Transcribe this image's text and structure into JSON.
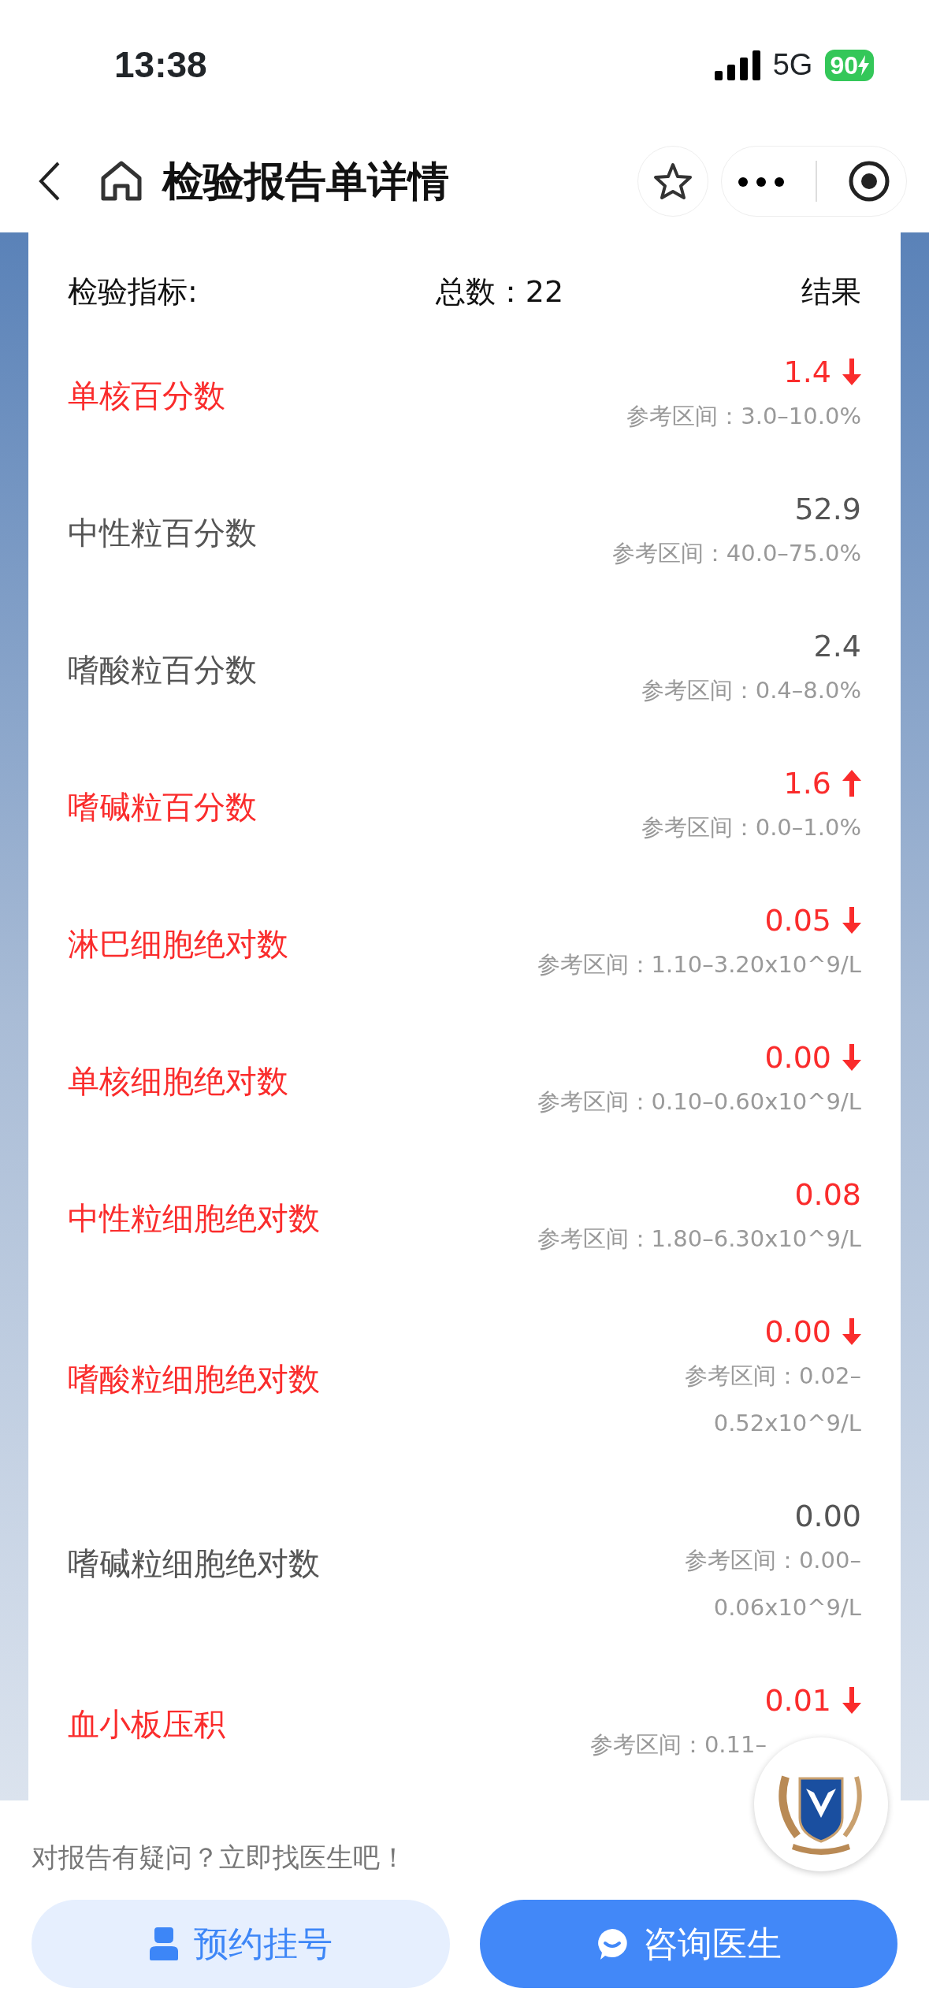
{
  "status_bar": {
    "time": "13:38",
    "network": "5G",
    "battery": "90",
    "charging": true
  },
  "nav": {
    "title": "检验报告单详情"
  },
  "header": {
    "label": "检验指标:",
    "total": "总数：22",
    "result": "结果"
  },
  "items": [
    {
      "name": "单核百分数",
      "value": "1.4",
      "abnormal": true,
      "low": true,
      "high": false,
      "reference": [
        "参考区间：3.0–10.0%"
      ]
    },
    {
      "name": "中性粒百分数",
      "value": "52.9",
      "abnormal": false,
      "low": false,
      "high": false,
      "reference": [
        "参考区间：40.0–75.0%"
      ]
    },
    {
      "name": "嗜酸粒百分数",
      "value": "2.4",
      "abnormal": false,
      "low": false,
      "high": false,
      "reference": [
        "参考区间：0.4–8.0%"
      ]
    },
    {
      "name": "嗜碱粒百分数",
      "value": "1.6",
      "abnormal": true,
      "low": false,
      "high": true,
      "reference": [
        "参考区间：0.0–1.0%"
      ]
    },
    {
      "name": "淋巴细胞绝对数",
      "value": "0.05",
      "abnormal": true,
      "low": true,
      "high": false,
      "reference": [
        "参考区间：1.10–3.20x10^9/L"
      ]
    },
    {
      "name": "单核细胞绝对数",
      "value": "0.00",
      "abnormal": true,
      "low": true,
      "high": false,
      "reference": [
        "参考区间：0.10–0.60x10^9/L"
      ]
    },
    {
      "name": "中性粒细胞绝对数",
      "value": "0.08",
      "abnormal": true,
      "low": false,
      "high": false,
      "reference": [
        "参考区间：1.80–6.30x10^9/L"
      ]
    },
    {
      "name": "嗜酸粒细胞绝对数",
      "value": "0.00",
      "abnormal": true,
      "low": true,
      "high": false,
      "reference": [
        "参考区间：0.02–",
        "0.52x10^9/L"
      ]
    },
    {
      "name": "嗜碱粒细胞绝对数",
      "value": "0.00",
      "abnormal": false,
      "low": false,
      "high": false,
      "reference": [
        "参考区间：0.00–",
        "0.06x10^9/L"
      ]
    },
    {
      "name": "血小板压积",
      "value": "0.01",
      "abnormal": true,
      "low": true,
      "high": false,
      "reference": [
        "参考区间：0.11–"
      ]
    }
  ],
  "footer": {
    "prompt": "对报告有疑问？立即找医生吧！",
    "buttons": [
      {
        "kind": "appointment",
        "label": "预约挂号"
      },
      {
        "kind": "consult",
        "label": "咨询医生"
      }
    ]
  }
}
